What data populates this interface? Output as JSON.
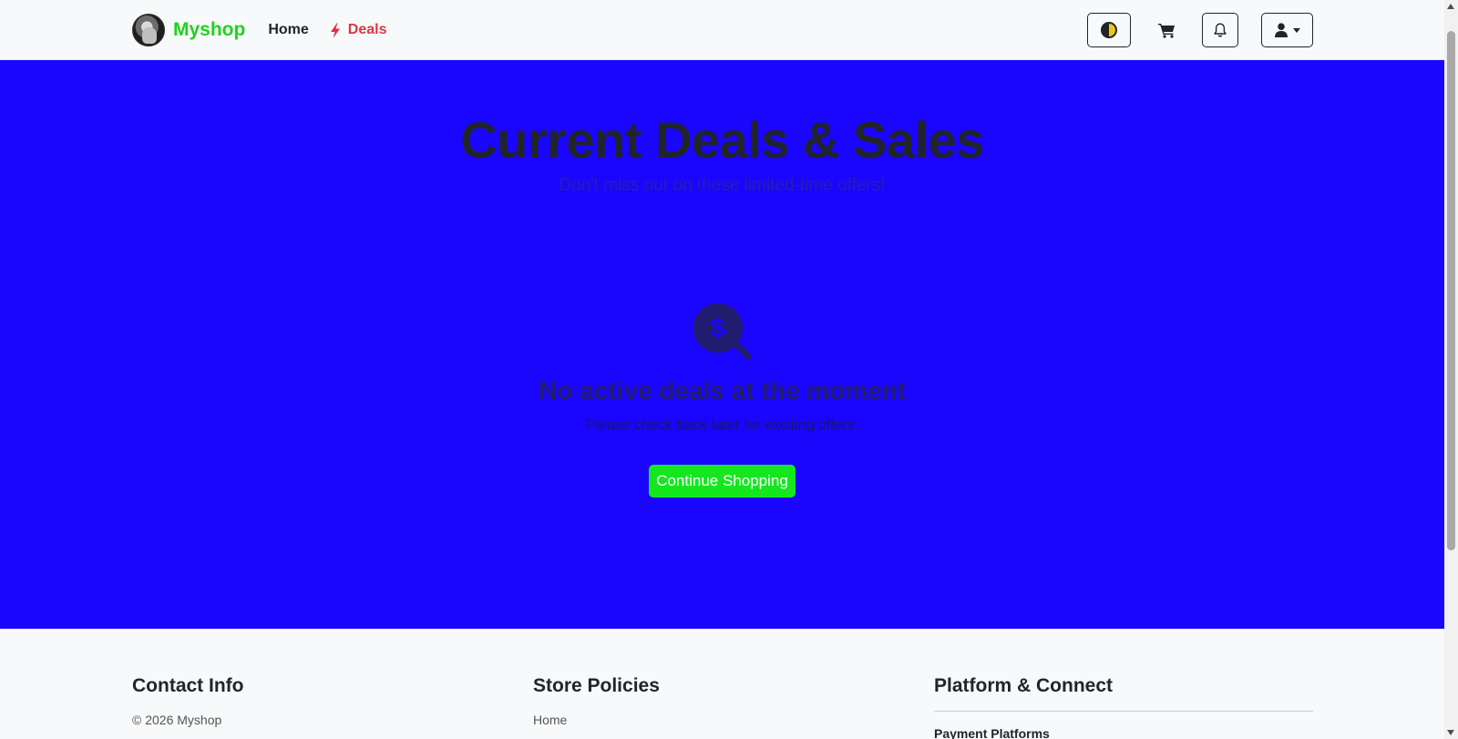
{
  "navbar": {
    "brand_name": "Myshop",
    "links": [
      {
        "label": "Home"
      },
      {
        "label": "Deals",
        "icon": "bolt-icon"
      }
    ],
    "icons": [
      "theme-toggle-icon",
      "cart-icon",
      "bell-icon",
      "user-icon"
    ]
  },
  "hero": {
    "title": "Current Deals & Sales",
    "subtitle": "Don't miss out on these limited-time offers!",
    "empty_icon": "search-dollar-icon",
    "empty_title": "No active deals at the moment",
    "empty_text": "Please check back later for exciting offers.",
    "cta_label": "Continue Shopping"
  },
  "footer": {
    "columns": [
      {
        "title": "Contact Info",
        "text": "© 2026 Myshop"
      },
      {
        "title": "Store Policies",
        "text": "Home"
      },
      {
        "title": "Platform & Connect",
        "text": "Payment Platforms"
      }
    ]
  },
  "colors": {
    "brand": "#1fd31f",
    "deals": "#dc3545",
    "hero_bg": "#1a06fc",
    "cta_bg": "#15e71f"
  }
}
